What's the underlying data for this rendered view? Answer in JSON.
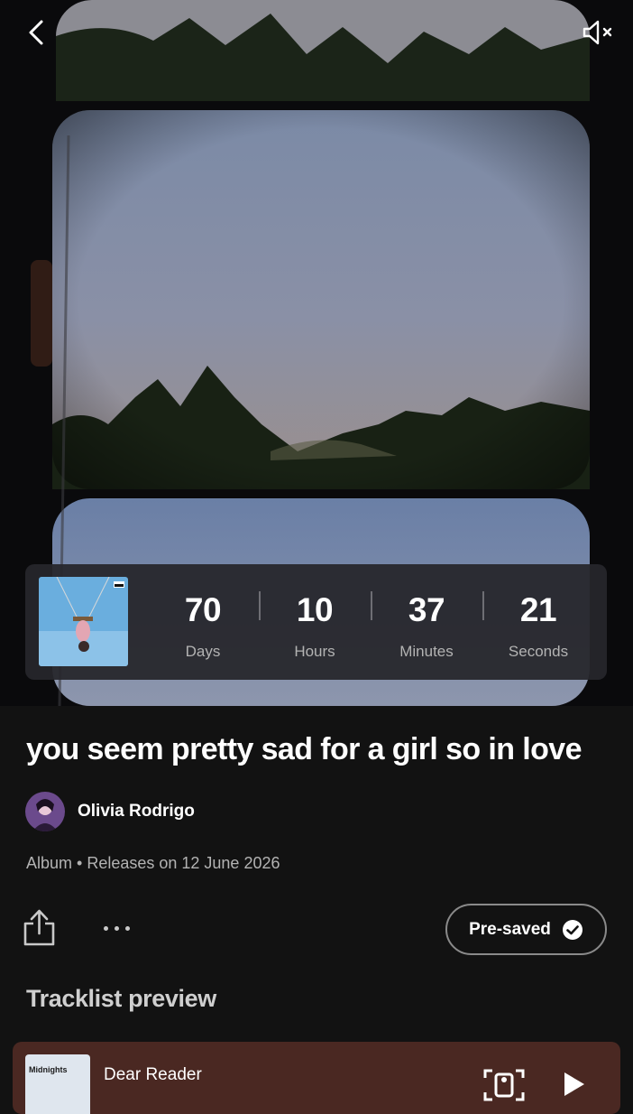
{
  "countdown": {
    "units": [
      {
        "value": "70",
        "label": "Days"
      },
      {
        "value": "10",
        "label": "Hours"
      },
      {
        "value": "37",
        "label": "Minutes"
      },
      {
        "value": "21",
        "label": "Seconds"
      }
    ]
  },
  "album": {
    "title": "you seem pretty sad for a girl so in love",
    "artist": "Olivia Rodrigo",
    "meta": "Album • Releases on 12 June 2026"
  },
  "actions": {
    "presave_label": "Pre-saved"
  },
  "tracklist": {
    "heading": "Tracklist preview",
    "items": [
      {
        "name": "Dear Reader",
        "cover_text": "Midnights"
      }
    ]
  },
  "colors": {
    "background": "#121212",
    "track_card": "#4a2822",
    "secondary_text": "#b3b3b3"
  }
}
